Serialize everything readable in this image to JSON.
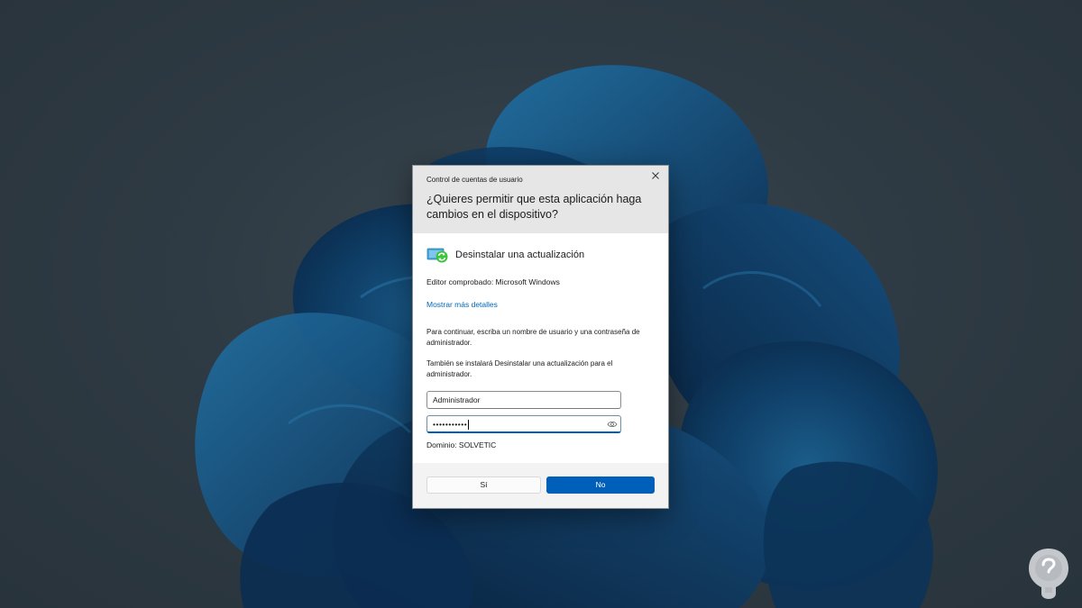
{
  "dialog": {
    "window_title": "Control de cuentas de usuario",
    "question": "¿Quieres permitir que esta aplicación haga cambios en el dispositivo?",
    "app_name": "Desinstalar una actualización",
    "publisher": "Editor comprobado: Microsoft Windows",
    "details_link": "Mostrar más detalles",
    "instruction": "Para continuar, escriba un nombre de usuario y una contraseña de administrador.",
    "also_install": "También se instalará Desinstalar una actualización para el administrador.",
    "username_value": "Administrador",
    "password_mask": "•••••••••••",
    "domain": "Dominio: SOLVETIC",
    "yes_label": "Sí",
    "no_label": "No"
  },
  "icons": {
    "close": "close-icon",
    "app": "update-refresh-icon",
    "reveal": "eye-icon",
    "watermark": "solvetic-logo"
  },
  "colors": {
    "accent": "#005fb8",
    "link": "#0067b8",
    "header_bg": "#e6e6e6",
    "footer_bg": "#f3f3f3"
  }
}
